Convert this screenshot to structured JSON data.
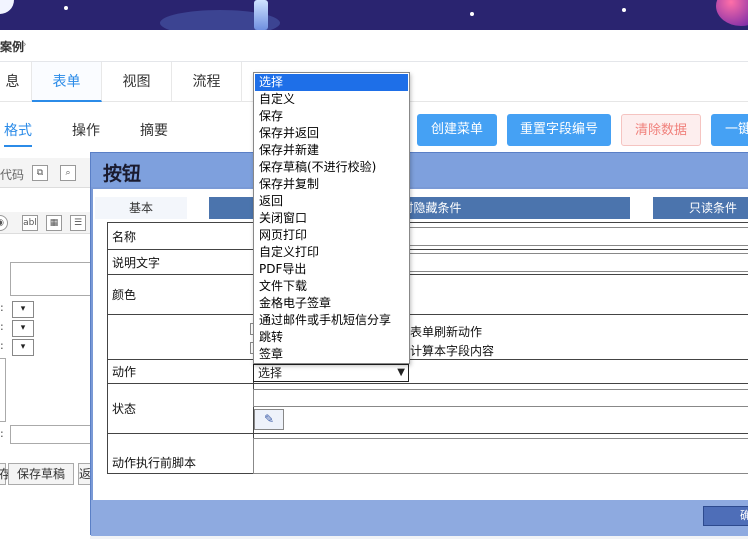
{
  "breadcrumb": {
    "current": "案例",
    "separator": "›"
  },
  "top_tabs": [
    {
      "label": "息",
      "active": false
    },
    {
      "label": "表单",
      "active": true
    },
    {
      "label": "视图",
      "active": false
    },
    {
      "label": "流程",
      "active": false
    }
  ],
  "sub_tabs": [
    {
      "label": "格式",
      "active": true
    },
    {
      "label": "操作",
      "active": false
    },
    {
      "label": "摘要",
      "active": false
    }
  ],
  "toolbar_buttons": {
    "create_menu": "创建菜单",
    "reset_field_numbers": "重置字段编号",
    "clear_data": "清除数据",
    "one_key": "一键"
  },
  "left_panel": {
    "code_label": "代码",
    "bottom_buttons": [
      "存",
      "保存草稿",
      "返"
    ]
  },
  "dialog": {
    "title": "按钮",
    "tabs": [
      "基本",
      "打印时隐藏条件",
      "只读条件"
    ],
    "rows": {
      "name": "名称",
      "description": "说明文字",
      "color": "颜色",
      "action": "动作",
      "status": "状态",
      "pre_script": "动作执行前脚本"
    },
    "checkbox_1_label": "表单刷新动作",
    "checkbox_2_label": "计算本字段内容",
    "action_value": "选择",
    "ok_label": "确"
  },
  "dropdown": {
    "options": [
      "选择",
      "自定义",
      "保存",
      "保存并返回",
      "保存并新建",
      "保存草稿(不进行校验)",
      "保存并复制",
      "返回",
      "关闭窗口",
      "网页打印",
      "自定义打印",
      "PDF导出",
      "文件下载",
      "金格电子签章",
      "通过邮件或手机短信分享",
      "跳转",
      "签章"
    ],
    "selected_index": 0
  }
}
